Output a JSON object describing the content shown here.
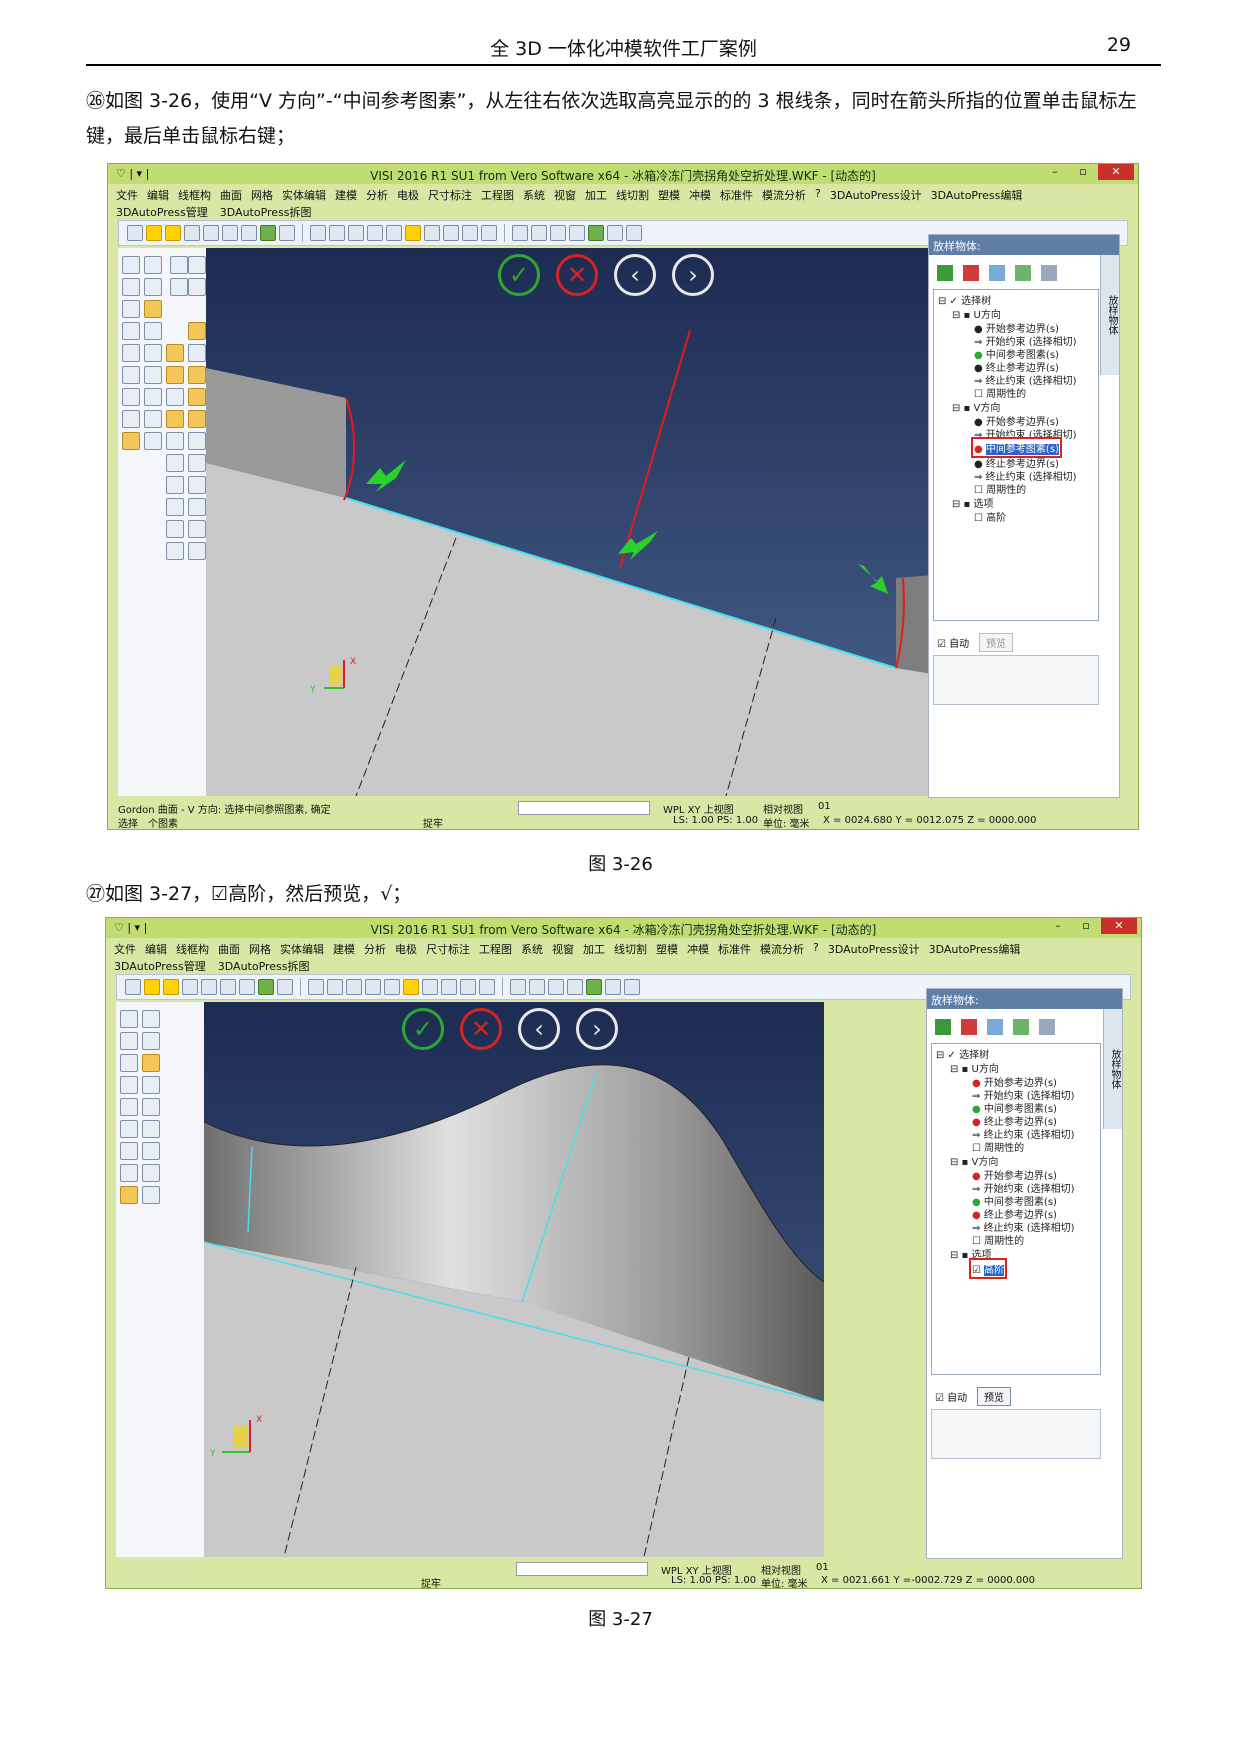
{
  "header": {
    "title": "全 3D 一体化冲模软件工厂案例",
    "page_number": "29"
  },
  "step26": {
    "text": "㉖如图 3-26，使用“V 方向”-“中间参考图素”，从左往右依次选取高亮显示的的 3 根线条，同时在箭头所指的位置单击鼠标左键，最后单击鼠标右键；"
  },
  "step27": {
    "text": "㉗如图 3-27，☑高阶，然后预览，√；"
  },
  "figure1": {
    "caption": "图 3-26",
    "title": "VISI 2016 R1 SU1 from Vero Software x64 - 冰箱冷冻门壳拐角处空折处理.WKF - [动态的]",
    "menu": [
      "文件",
      "编辑",
      "线框构",
      "曲面",
      "网格",
      "实体编辑",
      "建模",
      "分析",
      "电极",
      "尺寸标注",
      "工程图",
      "系统",
      "视窗",
      "加工",
      "线切割",
      "塑模",
      "冲模",
      "标准件",
      "模流分析",
      "?",
      "3DAutoPress设计",
      "3DAutoPress编辑"
    ],
    "menu2": [
      "3DAutoPress管理",
      "3DAutoPress拆图"
    ],
    "panel_title": "放样物体:",
    "side_tab": "放样物体",
    "tree": {
      "root": "选择树",
      "u_dir": "U方向",
      "u_items": [
        "开始参考边界(s)",
        "开始约束 (选择相切)",
        "中间参考图素(s)",
        "终止参考边界(s)",
        "终止约束 (选择相切)",
        "周期性的"
      ],
      "v_dir": "V方向",
      "v_items": [
        "开始参考边界(s)",
        "开始约束 (选择相切)",
        "中间参考图素(s)",
        "终止参考边界(s)",
        "终止约束 (选择相切)",
        "周期性的"
      ],
      "options": "选项",
      "option_item": "高阶"
    },
    "auto_label": "自动",
    "preview_label": "预览",
    "prompt": "Gordon 曲面 - V 方向: 选择中间参照图素, 确定",
    "view_label": "WPL XY 上视图",
    "relative_view": "相对视图",
    "layer": "01",
    "status_select": "选择",
    "status_count": "个图素",
    "status_snap": "捉牢",
    "ls_ps": "LS: 1.00 PS: 1.00",
    "unit": "单位: 毫米",
    "coords": "X = 0024.680 Y = 0012.075 Z = 0000.000"
  },
  "figure2": {
    "caption": "图 3-27",
    "title": "VISI 2016 R1 SU1 from Vero Software x64 - 冰箱冷冻门壳拐角处空折处理.WKF - [动态的]",
    "panel_title": "放样物体:",
    "auto_label": "自动",
    "preview_label": "预览",
    "view_label": "WPL XY 上视图",
    "relative_view": "相对视图",
    "layer": "01",
    "status_snap": "捉牢",
    "ls_ps": "LS: 1.00 PS: 1.00",
    "unit": "单位: 毫米",
    "coords": "X = 0021.661 Y =-0002.729 Z = 0000.000",
    "option_item": "高阶"
  },
  "colors": {
    "accent_green": "#2aa832",
    "accent_red": "#d42424",
    "viewport_top": "#1d2b52",
    "viewport_bottom": "#4a6590",
    "window_frame": "#c2dc74"
  }
}
